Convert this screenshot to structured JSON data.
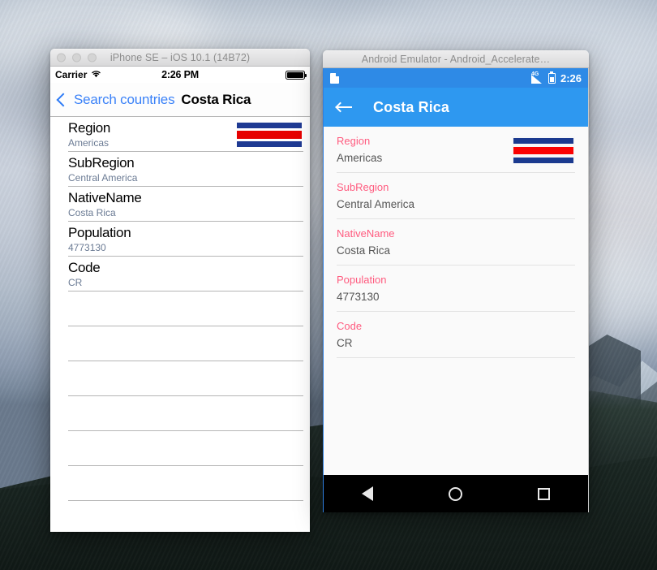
{
  "desktop": {
    "wallpaper_name": "yosemite-valley-wallpaper"
  },
  "ios_window": {
    "title": "iPhone SE – iOS 10.1 (14B72)",
    "traffic_lights": [
      "close-button",
      "minimize-button",
      "zoom-button"
    ],
    "status_bar": {
      "carrier": "Carrier",
      "wifi_icon": "wifi-icon",
      "time": "2:26 PM",
      "battery_icon": "battery-full-icon"
    },
    "nav_bar": {
      "back_icon": "chevron-left-icon",
      "back_label": "Search countries",
      "title": "Costa Rica"
    },
    "list": [
      {
        "label": "Region",
        "value": "Americas"
      },
      {
        "label": "SubRegion",
        "value": "Central America"
      },
      {
        "label": "NativeName",
        "value": "Costa Rica"
      },
      {
        "label": "Population",
        "value": "4773130"
      },
      {
        "label": "Code",
        "value": "CR"
      }
    ],
    "empty_rows": 6,
    "flag": {
      "name": "costa-rica-flag",
      "stripes": [
        "#1f3a93",
        "#ffffff",
        "#e60000",
        "#ffffff",
        "#1f3a93"
      ]
    },
    "colors": {
      "tint": "#3b82f8",
      "value_text": "#6b7b94",
      "separator": "#b5b5b5"
    }
  },
  "android_window": {
    "title": "Android Emulator - Android_Accelerate…",
    "status_bar": {
      "notification_icon": "sim-card-icon",
      "signal_icon": "signal-4g-icon",
      "signal_label": "4G",
      "battery_icon": "battery-charging-icon",
      "time": "2:26"
    },
    "toolbar": {
      "back_icon": "arrow-left-icon",
      "title": "Costa Rica"
    },
    "list": [
      {
        "label": "Region",
        "value": "Americas"
      },
      {
        "label": "SubRegion",
        "value": "Central America"
      },
      {
        "label": "NativeName",
        "value": "Costa Rica"
      },
      {
        "label": "Population",
        "value": "4773130"
      },
      {
        "label": "Code",
        "value": "CR"
      }
    ],
    "flag": {
      "name": "costa-rica-flag",
      "stripes": [
        "#1b3a8f",
        "#ffffff",
        "#fb0202",
        "#ffffff",
        "#1b3a8f"
      ]
    },
    "nav_buttons": [
      {
        "name": "nav-back-button",
        "icon": "triangle-back-icon"
      },
      {
        "name": "nav-home-button",
        "icon": "circle-home-icon"
      },
      {
        "name": "nav-recents-button",
        "icon": "square-recents-icon"
      }
    ],
    "colors": {
      "status_bar": "#2e8ae6",
      "toolbar": "#2e98f0",
      "label_accent": "#ff5b7f",
      "value_text": "#555555",
      "background": "#fafafa"
    }
  }
}
